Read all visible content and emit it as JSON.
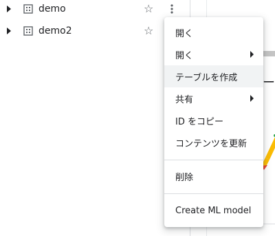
{
  "explorer": {
    "datasets": [
      {
        "name": "demo"
      },
      {
        "name": "demo2"
      }
    ]
  },
  "icons": {
    "expand": "chevron-right-icon",
    "dataset": "dataset-grid-icon",
    "star": "star-outline-icon",
    "more": "more-vert-icon",
    "star_glyph": "☆",
    "submenu": "submenu-arrow-icon"
  },
  "context_menu": {
    "items": [
      {
        "label": "開く"
      },
      {
        "label": "開く"
      },
      {
        "label": "テーブルを作成"
      },
      {
        "label": "共有"
      },
      {
        "label": "ID をコピー"
      },
      {
        "label": "コンテンツを更新"
      },
      {
        "label": "削除"
      },
      {
        "label": "Create ML model"
      }
    ]
  },
  "right_pane": {
    "partial_text": "ー"
  },
  "colors": {
    "text": "#202124",
    "icon": "#5f6368",
    "hover": "#f1f3f4",
    "divider": "#dadce0",
    "illustration_yellow": "#fbbc04",
    "illustration_red": "#ea4335",
    "illustration_green": "#34a853"
  }
}
